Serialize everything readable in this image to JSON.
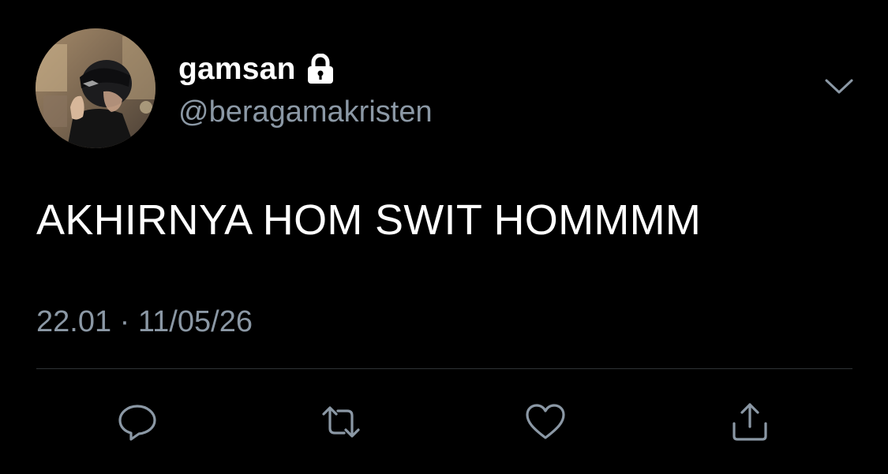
{
  "tweet": {
    "display_name": "gamsan",
    "handle": "@beragamakristen",
    "text": "AKHIRNYA HOM SWIT HOMMMM",
    "timestamp": "22.01 · 11/05/26",
    "protected_icon": "lock-icon",
    "menu_icon": "chevron-down-icon"
  },
  "actions": [
    {
      "name": "reply",
      "icon": "reply-icon"
    },
    {
      "name": "retweet",
      "icon": "retweet-icon"
    },
    {
      "name": "like",
      "icon": "heart-icon"
    },
    {
      "name": "share",
      "icon": "share-icon"
    }
  ],
  "colors": {
    "background": "#000000",
    "primary_text": "#ffffff",
    "secondary_text": "#8b98a5",
    "divider": "#2f3336"
  }
}
